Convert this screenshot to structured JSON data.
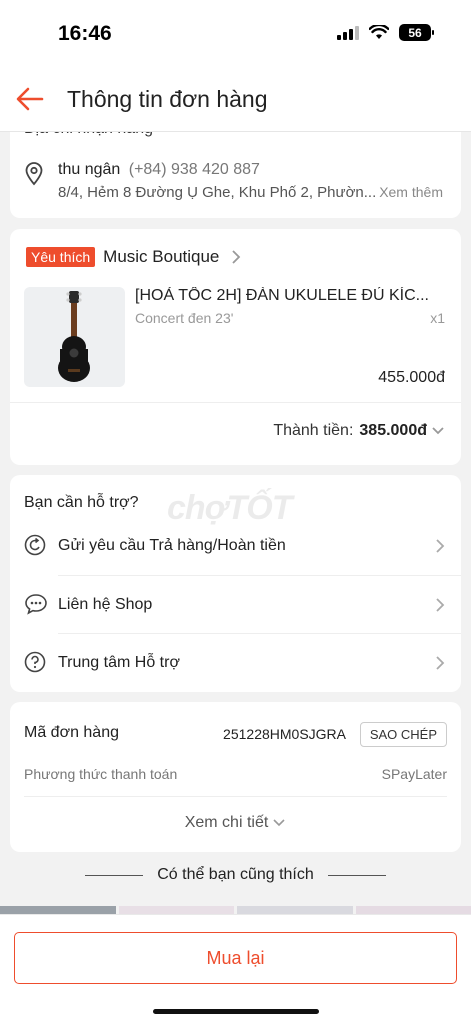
{
  "status": {
    "time": "16:46",
    "battery": "56"
  },
  "header": {
    "title": "Thông tin đơn hàng"
  },
  "address": {
    "heading": "Địa chỉ nhận hàng",
    "name": "thu ngân",
    "phone": "(+84) 938 420 887",
    "line": "8/4, Hẻm 8 Đường Ụ Ghe, Khu Phố 2, Phườn...",
    "more": "Xem thêm"
  },
  "shop": {
    "badge": "Yêu thích",
    "name": "Music Boutique"
  },
  "product": {
    "name": "[HOẢ TỐC 2H] ĐÀN UKULELE ĐỦ KÍC...",
    "variant": "Concert đen 23'",
    "qty": "x1",
    "price": "455.000đ",
    "total_label": "Thành tiền:",
    "total": "385.000đ"
  },
  "help": {
    "title": "Bạn cần hỗ trợ?",
    "items": [
      {
        "label": "Gửi yêu cầu Trả hàng/Hoàn tiền",
        "icon": "return-icon"
      },
      {
        "label": "Liên hệ Shop",
        "icon": "chat-icon"
      },
      {
        "label": "Trung tâm Hỗ trợ",
        "icon": "help-icon"
      }
    ],
    "watermark": "chợTỐT"
  },
  "order": {
    "code_label": "Mã đơn hàng",
    "code": "251228HM0SJGRA",
    "copy": "SAO CHÉP",
    "payment_label": "Phương thức thanh toán",
    "payment_value": "SPayLater",
    "detail_link": "Xem chi tiết"
  },
  "suggestions": {
    "title": "Có thể bạn cũng thích"
  },
  "actions": {
    "rebuy": "Mua lại"
  },
  "colors": {
    "accent": "#ee4d2d",
    "background": "#f2f2f2"
  }
}
